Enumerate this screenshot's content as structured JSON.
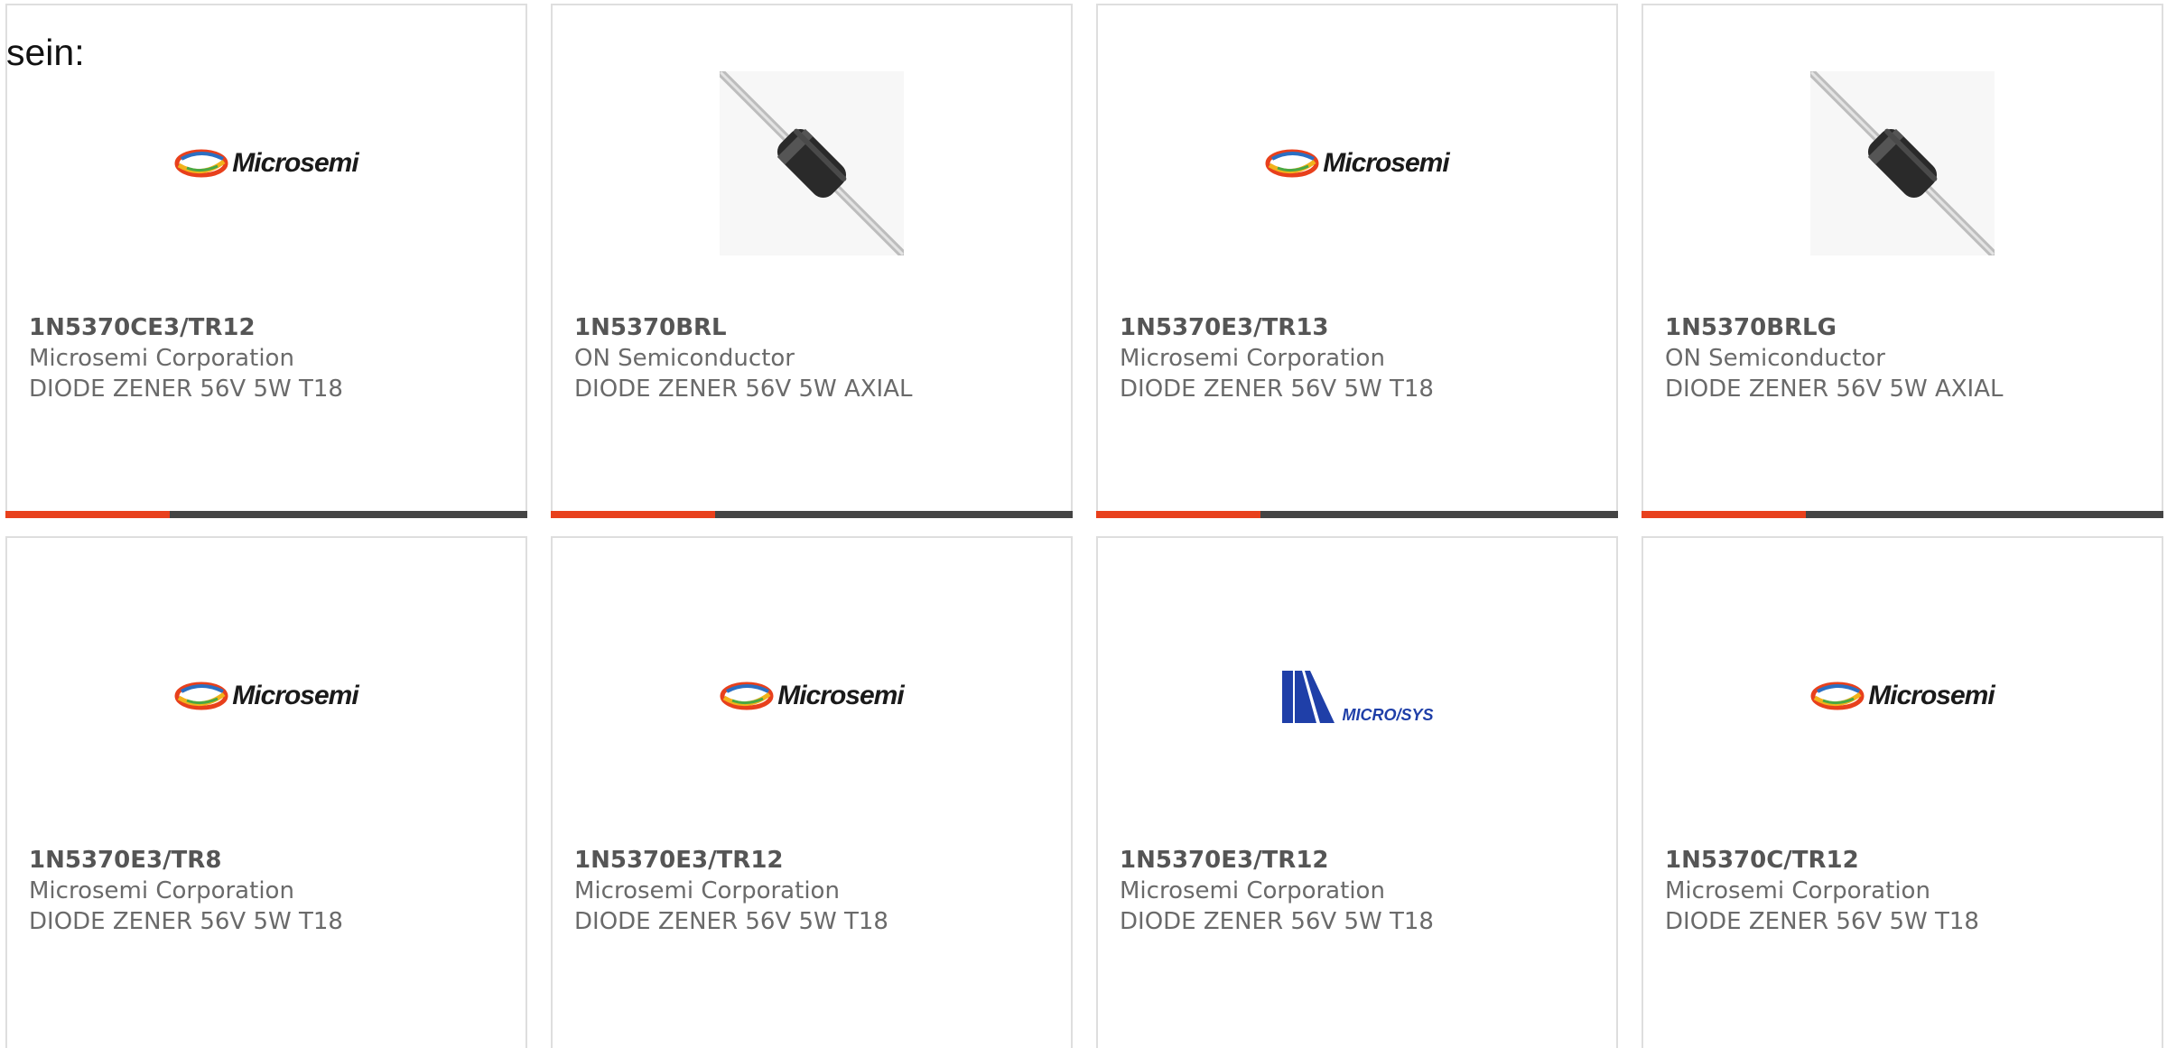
{
  "intro_text": "sein:",
  "colors": {
    "accent": "#e8401c",
    "bar": "#444444",
    "border": "#dedede",
    "microsys_blue": "#1f3fa8"
  },
  "products": [
    {
      "part": "1N5370CE3/TR12",
      "manufacturer": "Microsemi Corporation",
      "description": "DIODE ZENER 56V 5W T18",
      "image": "microsemi-logo"
    },
    {
      "part": "1N5370BRL",
      "manufacturer": "ON Semiconductor",
      "description": "DIODE ZENER 56V 5W AXIAL",
      "image": "axial-diode"
    },
    {
      "part": "1N5370E3/TR13",
      "manufacturer": "Microsemi Corporation",
      "description": "DIODE ZENER 56V 5W T18",
      "image": "microsemi-logo"
    },
    {
      "part": "1N5370BRLG",
      "manufacturer": "ON Semiconductor",
      "description": "DIODE ZENER 56V 5W AXIAL",
      "image": "axial-diode"
    },
    {
      "part": "1N5370E3/TR8",
      "manufacturer": "Microsemi Corporation",
      "description": "DIODE ZENER 56V 5W T18",
      "image": "microsemi-logo"
    },
    {
      "part": "1N5370E3/TR12",
      "manufacturer": "Microsemi Corporation",
      "description": "DIODE ZENER 56V 5W T18",
      "image": "microsemi-logo"
    },
    {
      "part": "1N5370E3/TR12",
      "manufacturer": "Microsemi Corporation",
      "description": "DIODE ZENER 56V 5W T18",
      "image": "microsys-logo"
    },
    {
      "part": "1N5370C/TR12",
      "manufacturer": "Microsemi Corporation",
      "description": "DIODE ZENER 56V 5W T18",
      "image": "microsemi-logo"
    }
  ],
  "logos": {
    "microsemi_text": "Microsemi",
    "microsys_text": "MICRO/SYS"
  }
}
